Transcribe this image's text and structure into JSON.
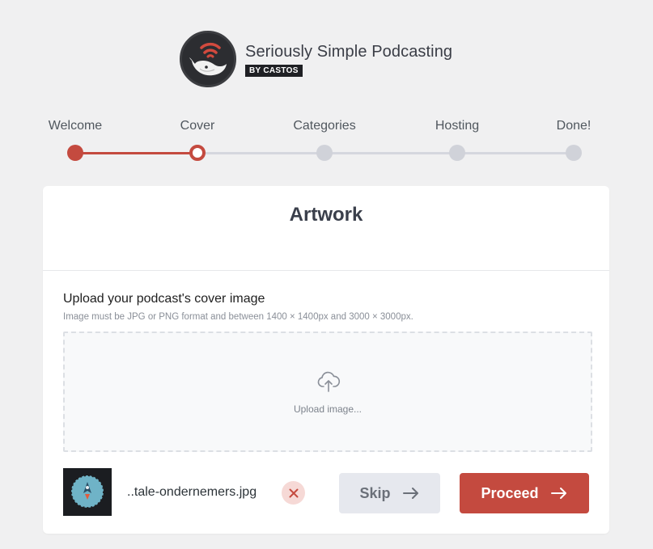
{
  "brand": {
    "title": "Seriously Simple Podcasting",
    "badge": "BY CASTOS",
    "logo_icon": "whale-broadcast-icon"
  },
  "steps": [
    {
      "label": "Welcome",
      "state": "done"
    },
    {
      "label": "Cover",
      "state": "current"
    },
    {
      "label": "Categories",
      "state": "upcoming"
    },
    {
      "label": "Hosting",
      "state": "upcoming"
    },
    {
      "label": "Done!",
      "state": "upcoming"
    }
  ],
  "card": {
    "title": "Artwork",
    "field_label": "Upload your podcast's cover image",
    "field_hint": "Image must be JPG or PNG format and between 1400 × 1400px and 3000 × 3000px.",
    "dropzone": {
      "text": "Upload image...",
      "icon": "cloud-upload-icon"
    },
    "file": {
      "name": "..tale-ondernemers.jpg",
      "remove_icon": "close-icon"
    },
    "buttons": {
      "skip": "Skip",
      "proceed": "Proceed"
    }
  },
  "colors": {
    "accent": "#c44a3f",
    "background": "#f0f0f1",
    "inactive": "#d0d2d9"
  }
}
